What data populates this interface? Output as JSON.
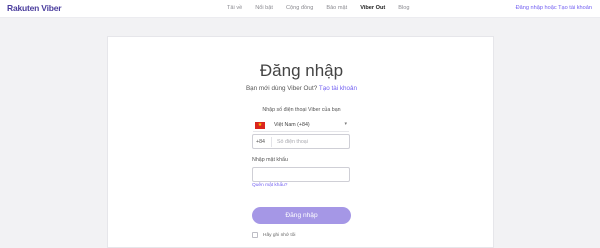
{
  "header": {
    "logo_text": "Rakuten Viber",
    "nav": [
      "Tải về",
      "Nổi bật",
      "Cộng đồng",
      "Bảo mật",
      "Viber Out",
      "Blog"
    ],
    "active_nav": "Viber Out",
    "auth_text": "Đăng nhập hoặc Tạo tài khoản"
  },
  "form": {
    "title": "Đăng nhập",
    "subtitle_prefix": "Bạn mới dùng Viber Out?",
    "subtitle_link": "Tạo tài khoản",
    "phone_label": "Nhập số điện thoại Viber của bạn",
    "country": "Việt Nam (+84)",
    "dial_code": "+84",
    "phone_placeholder": "Số điện thoại",
    "phone_value": "",
    "password_label": "Nhập mật khẩu",
    "password_value": "",
    "forgot_text": "Quên mật khẩu?",
    "submit_label": "Đăng nhập",
    "remember_label": "Hãy ghi nhớ tôi"
  },
  "icons": {
    "flag": "vietnam-flag-icon",
    "dropdown": "chevron-down-icon"
  },
  "colors": {
    "accent": "#7360f2",
    "button_disabled": "#a597e6",
    "flag_red": "#da251d",
    "flag_star": "#ffcd00"
  }
}
